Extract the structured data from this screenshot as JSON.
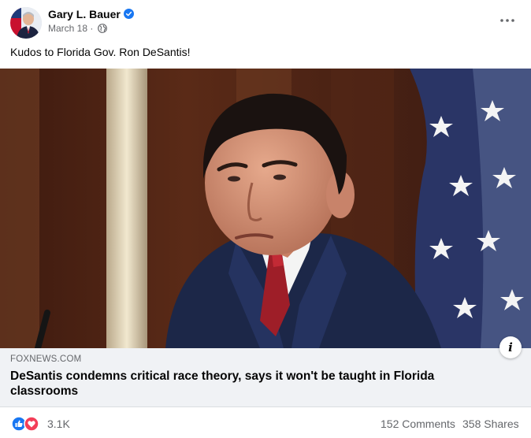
{
  "post": {
    "author": "Gary L. Bauer",
    "date": "March 18",
    "separator": "·",
    "privacy_icon": "globe-icon",
    "verified_icon": "verified-badge-icon",
    "text": "Kudos to Florida Gov. Ron DeSantis!"
  },
  "link": {
    "domain": "FOXNEWS.COM",
    "headline": "DeSantis condemns critical race theory, says it won't be taught in Florida classrooms",
    "info_icon": "i"
  },
  "stats": {
    "reactions": "3.1K",
    "reaction_icons": [
      "like-icon",
      "love-icon"
    ],
    "comments": "152 Comments",
    "shares": "358 Shares"
  },
  "colors": {
    "like_blue": "#1877f2",
    "love_red": "#f33e58",
    "link_bg": "#f0f2f5",
    "secondary_text": "#65676b"
  }
}
